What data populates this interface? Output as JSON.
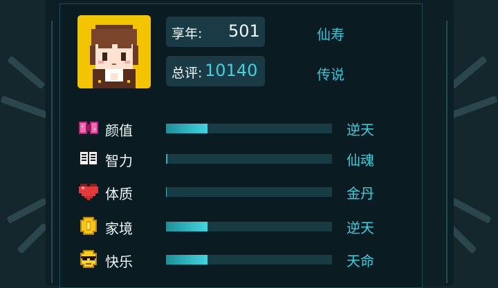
{
  "profile": {
    "age_label": "享年:",
    "age_value": "501",
    "age_rank": "仙寿",
    "score_label": "总评:",
    "score_value": "10140",
    "score_rank": "传说"
  },
  "attributes": [
    {
      "label": "颜值",
      "grade": "逆天",
      "icon": "bow-icon",
      "level": 0.25
    },
    {
      "label": "智力",
      "grade": "仙魂",
      "icon": "book-icon",
      "level": 0.01
    },
    {
      "label": "体质",
      "grade": "金丹",
      "icon": "heart-icon",
      "level": 0.005
    },
    {
      "label": "家境",
      "grade": "逆天",
      "icon": "coin-icon",
      "level": 0.25
    },
    {
      "label": "快乐",
      "grade": "天命",
      "icon": "sunglasses-icon",
      "level": 0.25
    }
  ],
  "colors": {
    "accent": "#3fd1dd",
    "bar_track": "#173c44",
    "avatar_bg": "#f3c400"
  }
}
